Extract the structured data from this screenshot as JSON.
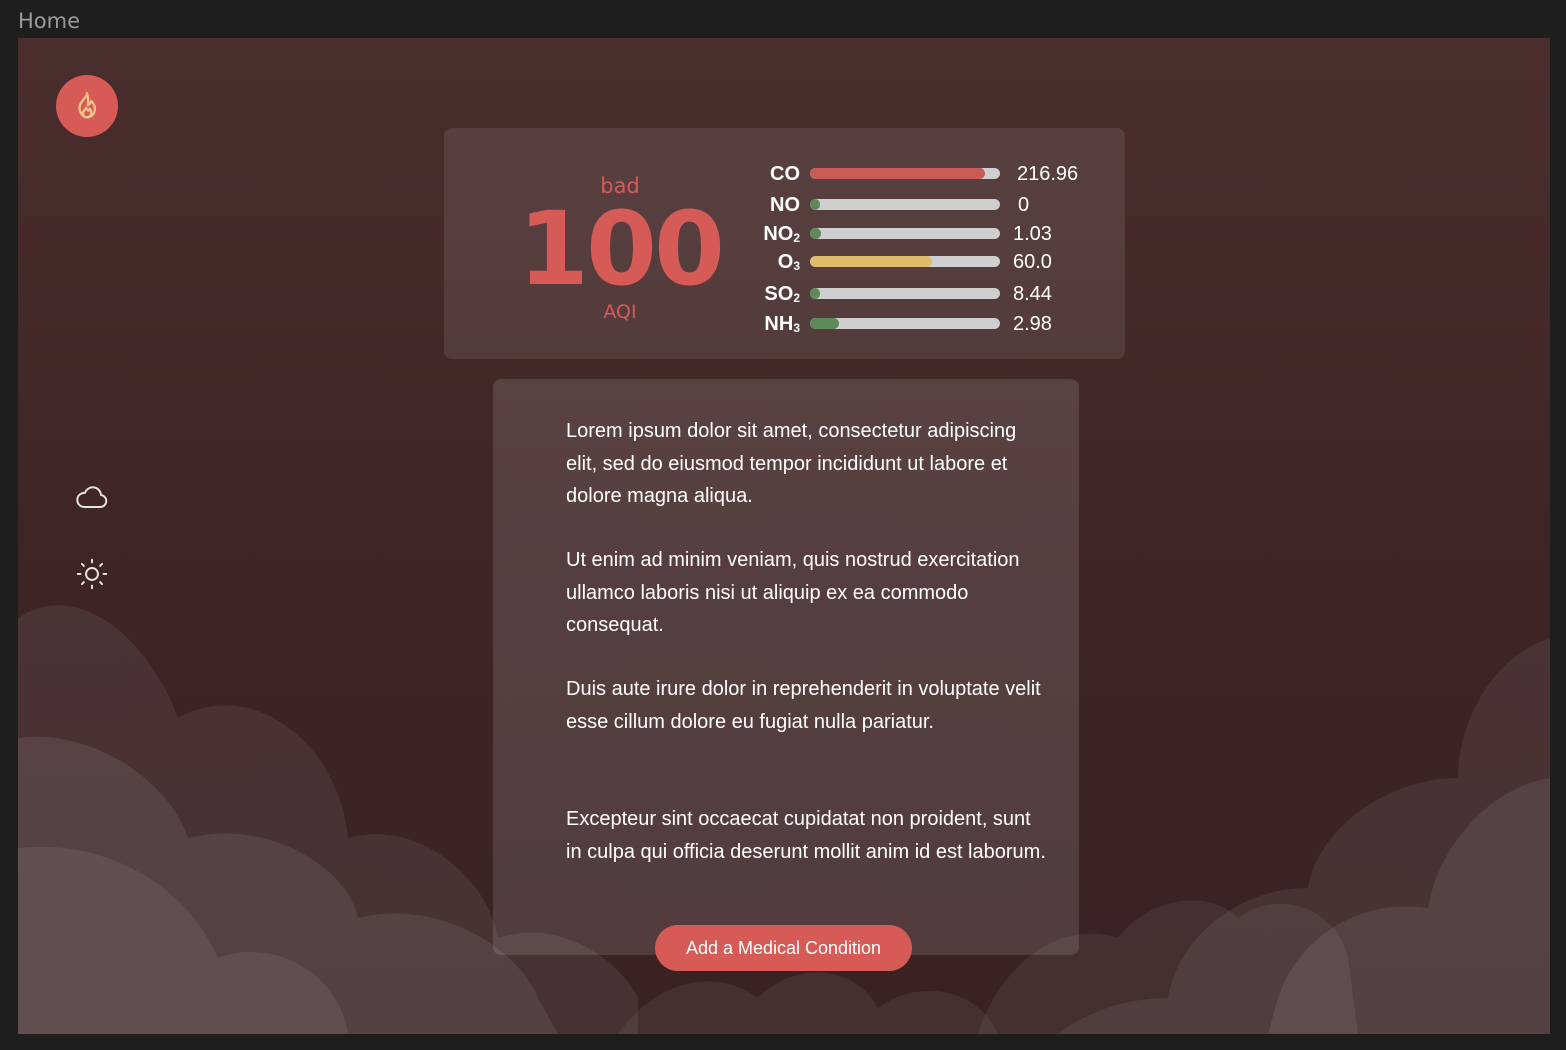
{
  "window": {
    "title": "Home"
  },
  "sidebar": {
    "top_icon": "flame-icon",
    "icons": [
      "cloud-icon",
      "sun-icon"
    ]
  },
  "aqi": {
    "status": "bad",
    "value": "100",
    "unit": "AQI",
    "pollutants": [
      {
        "name": "CO",
        "sub": "",
        "value": "216.96",
        "level": 0.92,
        "color": "#c85a57"
      },
      {
        "name": "NO",
        "sub": "",
        "value": "0",
        "level": 0.04,
        "color": "#5e8a5a"
      },
      {
        "name": "NO",
        "sub": "2",
        "value": "1.03",
        "level": 0.06,
        "color": "#5e8a5a"
      },
      {
        "name": "O",
        "sub": "3",
        "value": "60.0",
        "level": 0.64,
        "color": "#e0bd6a"
      },
      {
        "name": "SO",
        "sub": "2",
        "value": "8.44",
        "level": 0.04,
        "color": "#5e8a5a"
      },
      {
        "name": "NH",
        "sub": "3",
        "value": "2.98",
        "level": 0.15,
        "color": "#5e8a5a"
      }
    ]
  },
  "content": {
    "paragraphs": [
      "Lorem ipsum dolor sit amet, consectetur adipiscing elit, sed do eiusmod tempor incididunt ut labore et dolore magna aliqua.",
      "Ut enim ad minim veniam, quis nostrud exercitation ullamco laboris nisi ut aliquip ex ea commodo consequat.",
      "Duis aute irure dolor in reprehenderit in voluptate velit esse cillum dolore eu fugiat nulla pariatur.",
      "Excepteur sint occaecat cupidatat non proident, sunt in culpa qui officia deserunt mollit anim id est laborum."
    ],
    "button_label": "Add a Medical Condition"
  },
  "colors": {
    "accent": "#d65b57",
    "background": "#3e2425"
  }
}
